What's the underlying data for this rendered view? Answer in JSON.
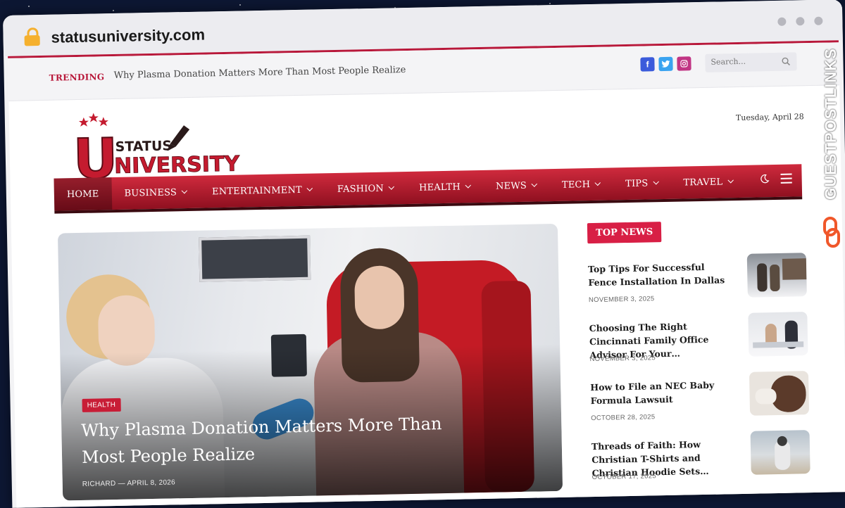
{
  "browser": {
    "url": "statusuniversity.com"
  },
  "topbar": {
    "trending_label": "TRENDING",
    "trending_text": "Why Plasma Donation Matters More Than Most People Realize",
    "socials": [
      {
        "name": "facebook",
        "glyph": "f"
      },
      {
        "name": "twitter",
        "glyph": "t"
      },
      {
        "name": "instagram",
        "glyph": "◎"
      }
    ],
    "search_placeholder": "Search..."
  },
  "header": {
    "logo_line1": "STATUS",
    "logo_line2": "NIVERSITY",
    "logo_letter": "U",
    "date": "Tuesday, April 28"
  },
  "nav": {
    "items": [
      {
        "label": "HOME",
        "active": true,
        "dropdown": false
      },
      {
        "label": "BUSINESS",
        "active": false,
        "dropdown": true
      },
      {
        "label": "ENTERTAINMENT",
        "active": false,
        "dropdown": true
      },
      {
        "label": "FASHION",
        "active": false,
        "dropdown": true
      },
      {
        "label": "HEALTH",
        "active": false,
        "dropdown": true
      },
      {
        "label": "NEWS",
        "active": false,
        "dropdown": true
      },
      {
        "label": "TECH",
        "active": false,
        "dropdown": true
      },
      {
        "label": "TIPS",
        "active": false,
        "dropdown": true
      },
      {
        "label": "TRAVEL",
        "active": false,
        "dropdown": true
      }
    ]
  },
  "hero": {
    "category": "HEALTH",
    "title": "Why Plasma Donation Matters More Than Most People Realize",
    "author": "RICHARD",
    "separator": "—",
    "date": "APRIL 8, 2026"
  },
  "top_news": {
    "heading": "TOP NEWS",
    "items": [
      {
        "title": "Top Tips For Successful Fence Installation In Dallas",
        "date": "NOVEMBER 3, 2025"
      },
      {
        "title": "Choosing The Right Cincinnati Family Office Advisor For Your…",
        "date": "NOVEMBER 3, 2025"
      },
      {
        "title": "How to File an NEC Baby Formula Lawsuit",
        "date": "OCTOBER 28, 2025"
      },
      {
        "title": "Threads of Faith: How Christian T-Shirts and Christian Hoodie Sets…",
        "date": "OCTOBER 17, 2025"
      }
    ]
  },
  "watermark": {
    "text": "GUESTPOSTLINKS"
  },
  "colors": {
    "brand_red": "#b8183a",
    "nav_red": "#cf2a3d",
    "badge_red": "#d81f45"
  }
}
